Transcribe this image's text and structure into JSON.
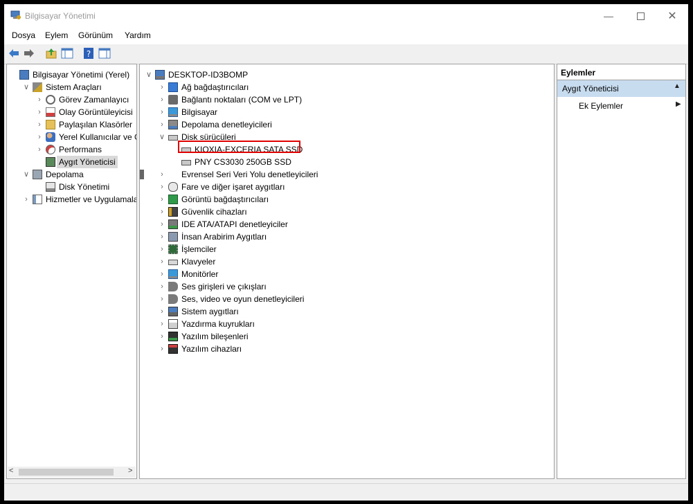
{
  "window": {
    "title": "Bilgisayar Yönetimi"
  },
  "menu": [
    "Dosya",
    "Eylem",
    "Görünüm",
    "Yardım"
  ],
  "icons": {
    "back": "back-arrow-icon",
    "forward": "forward-arrow-icon",
    "up": "folder-up-icon",
    "show_hide": "console-tree-icon",
    "help": "help-icon",
    "properties": "properties-icon"
  },
  "left_tree": [
    {
      "label": "Bilgisayar Yönetimi (Yerel)",
      "chev": "",
      "icon": "computer-management-icon"
    },
    {
      "label": "Sistem Araçları",
      "chev": "∨",
      "icon": "tools-icon"
    },
    {
      "label": "Görev Zamanlayıcı",
      "chev": "›",
      "icon": "clock-icon"
    },
    {
      "label": "Olay Görüntüleyicisi",
      "chev": "›",
      "icon": "event-viewer-icon"
    },
    {
      "label": "Paylaşılan Klasörler",
      "chev": "›",
      "icon": "shared-folder-icon"
    },
    {
      "label": "Yerel Kullanıcılar ve Gru",
      "chev": "›",
      "icon": "users-icon"
    },
    {
      "label": "Performans",
      "chev": "›",
      "icon": "performance-icon"
    },
    {
      "label": "Aygıt Yöneticisi",
      "chev": "",
      "icon": "device-manager-icon"
    },
    {
      "label": "Depolama",
      "chev": "∨",
      "icon": "storage-icon"
    },
    {
      "label": "Disk Yönetimi",
      "chev": "",
      "icon": "disk-management-icon"
    },
    {
      "label": "Hizmetler ve Uygulamalar",
      "chev": "›",
      "icon": "services-icon"
    }
  ],
  "device_tree": {
    "root": "DESKTOP-ID3BOMP",
    "categories": [
      {
        "label": "Ağ bağdaştırıcıları",
        "icon": "network-adapter-icon"
      },
      {
        "label": "Bağlantı noktaları (COM ve LPT)",
        "icon": "port-icon"
      },
      {
        "label": "Bilgisayar",
        "icon": "monitor-icon"
      },
      {
        "label": "Depolama denetleyicileri",
        "icon": "storage-controller-icon"
      },
      {
        "label": "Disk sürücüleri",
        "icon": "disk-drive-icon",
        "expanded": true,
        "children": [
          "KIOXIA-EXCERIA SATA SSD",
          "PNY CS3030 250GB SSD"
        ]
      },
      {
        "label": "Evrensel Seri Veri Yolu denetleyicileri",
        "icon": "usb-icon"
      },
      {
        "label": "Fare ve diğer işaret aygıtları",
        "icon": "mouse-icon"
      },
      {
        "label": "Görüntü bağdaştırıcıları",
        "icon": "display-adapter-icon"
      },
      {
        "label": "Güvenlik cihazları",
        "icon": "security-device-icon"
      },
      {
        "label": "IDE ATA/ATAPI denetleyiciler",
        "icon": "ide-icon"
      },
      {
        "label": "İnsan Arabirim Aygıtları",
        "icon": "hid-icon"
      },
      {
        "label": "İşlemciler",
        "icon": "processor-icon"
      },
      {
        "label": "Klavyeler",
        "icon": "keyboard-icon"
      },
      {
        "label": "Monitörler",
        "icon": "monitor-icon"
      },
      {
        "label": "Ses girişleri ve çıkışları",
        "icon": "speaker-icon"
      },
      {
        "label": "Ses, video ve oyun denetleyicileri",
        "icon": "speaker-icon"
      },
      {
        "label": "Sistem aygıtları",
        "icon": "system-device-icon"
      },
      {
        "label": "Yazdırma kuyrukları",
        "icon": "printer-icon"
      },
      {
        "label": "Yazılım bileşenleri",
        "icon": "software-component-icon"
      },
      {
        "label": "Yazılım cihazları",
        "icon": "software-device-icon"
      }
    ],
    "highlighted_item": "KIOXIA-EXCERIA SATA SSD",
    "highlight_color": "#e00000"
  },
  "actions": {
    "header": "Eylemler",
    "section": "Aygıt Yöneticisi",
    "item": "Ek Eylemler"
  },
  "colors": {
    "actions_section_bg": "#c7dcef",
    "selection_bg": "#d9d9d9"
  }
}
